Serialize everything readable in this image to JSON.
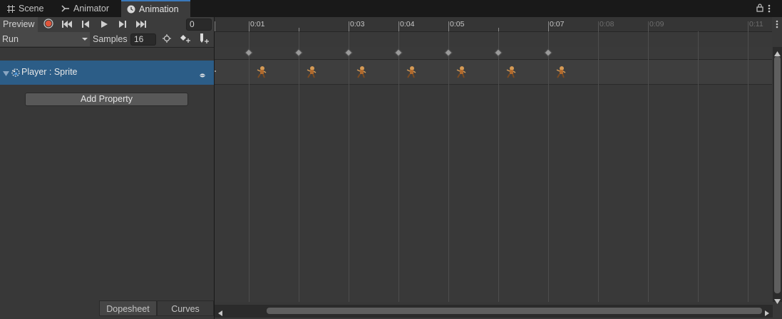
{
  "tabs": [
    {
      "label": "Scene",
      "icon": "grid-icon"
    },
    {
      "label": "Animator",
      "icon": "animator-icon"
    },
    {
      "label": "Animation",
      "icon": "clock-icon",
      "active": true
    }
  ],
  "toolbar": {
    "preview_label": "Preview",
    "frame_value": "0",
    "clip_name": "Run",
    "samples_label": "Samples",
    "samples_value": "16"
  },
  "property": {
    "label": "Player : Sprite"
  },
  "add_property_label": "Add Property",
  "bottom_tabs": {
    "dopesheet": "Dopesheet",
    "curves": "Curves"
  },
  "ruler_ticks": [
    "0:01",
    "0:03",
    "0:04",
    "0:05",
    "0:07",
    "0:08",
    "0:09",
    "0:11"
  ],
  "ruler_ticks_dim": [
    "0:08",
    "0:09",
    "0:11"
  ],
  "keyframe_count": 7,
  "colors": {
    "record": "#e0553a",
    "selection": "#2c5d87",
    "accent": "#3a79bb"
  }
}
